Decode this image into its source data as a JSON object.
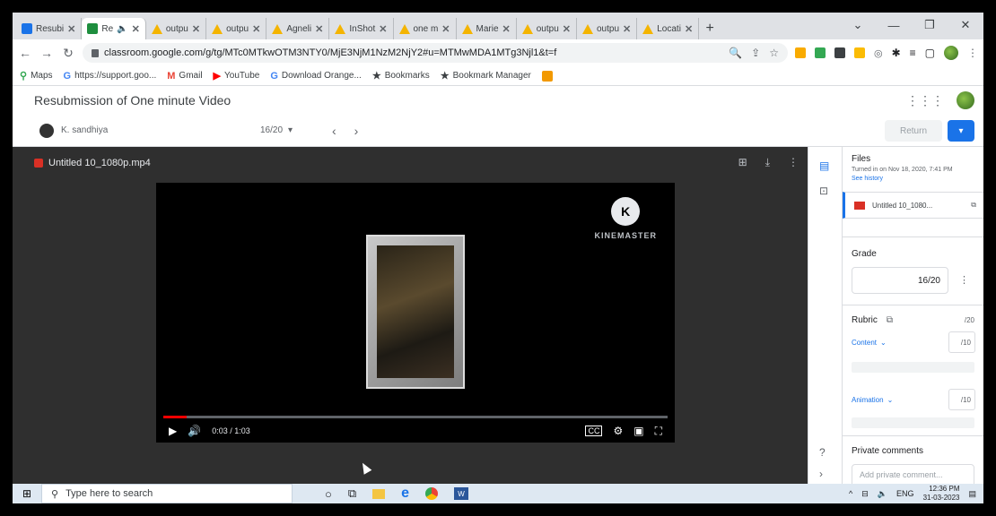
{
  "browser": {
    "tabs": [
      {
        "label": "Resubi",
        "icon": "classroom-icon",
        "active": false
      },
      {
        "label": "Re",
        "icon": "classroom-icon",
        "active": true
      },
      {
        "label": "outpu",
        "icon": "drive-icon",
        "active": false
      },
      {
        "label": "outpu",
        "icon": "drive-icon",
        "active": false
      },
      {
        "label": "Agneli",
        "icon": "drive-icon",
        "active": false
      },
      {
        "label": "InShot",
        "icon": "drive-icon",
        "active": false
      },
      {
        "label": "one m",
        "icon": "drive-icon",
        "active": false
      },
      {
        "label": "Marie",
        "icon": "drive-icon",
        "active": false
      },
      {
        "label": "outpu",
        "icon": "drive-icon",
        "active": false
      },
      {
        "label": "outpu",
        "icon": "drive-icon",
        "active": false
      },
      {
        "label": "Locati",
        "icon": "drive-icon",
        "active": false
      }
    ],
    "url": "classroom.google.com/g/tg/MTc0MTkwOTM3NTY0/MjE3NjM1NzM2NjY2#u=MTMwMDA1MTg3Njl1&t=f",
    "bookmarks": [
      {
        "label": "Maps",
        "icon": "maps-icon"
      },
      {
        "label": "https://support.goo...",
        "icon": "google-icon"
      },
      {
        "label": "Gmail",
        "icon": "gmail-icon"
      },
      {
        "label": "YouTube",
        "icon": "youtube-icon"
      },
      {
        "label": "Download Orange...",
        "icon": "google-icon"
      },
      {
        "label": "Bookmarks",
        "icon": "star-icon"
      },
      {
        "label": "Bookmark Manager",
        "icon": "star-icon"
      }
    ]
  },
  "app": {
    "title": "Resubmission of One minute Video",
    "student_name": "K. sandhiya",
    "score": "16/20",
    "return_label": "Return"
  },
  "viewer": {
    "file_name": "Untitled 10_1080p.mp4",
    "watermark": "KINEMASTER",
    "watermark_letter": "K",
    "time": "0:03 / 1:03",
    "progress": 0.047
  },
  "panel": {
    "files_title": "Files",
    "turned_in": "Turned in on Nov 18, 2020, 7:41 PM",
    "see_history": "See history",
    "attachment": "Untitled 10_1080...",
    "grade_title": "Grade",
    "grade_value": "16/20",
    "rubric_title": "Rubric",
    "rubric_points": "/20",
    "criteria": [
      {
        "label": "Content",
        "points": "/10"
      },
      {
        "label": "Animation",
        "points": "/10"
      }
    ],
    "private_comments_title": "Private comments",
    "private_comment_placeholder": "Add private comment..."
  },
  "taskbar": {
    "search_placeholder": "Type here to search",
    "language": "ENG",
    "time": "12:36 PM",
    "date": "31-03-2023"
  }
}
